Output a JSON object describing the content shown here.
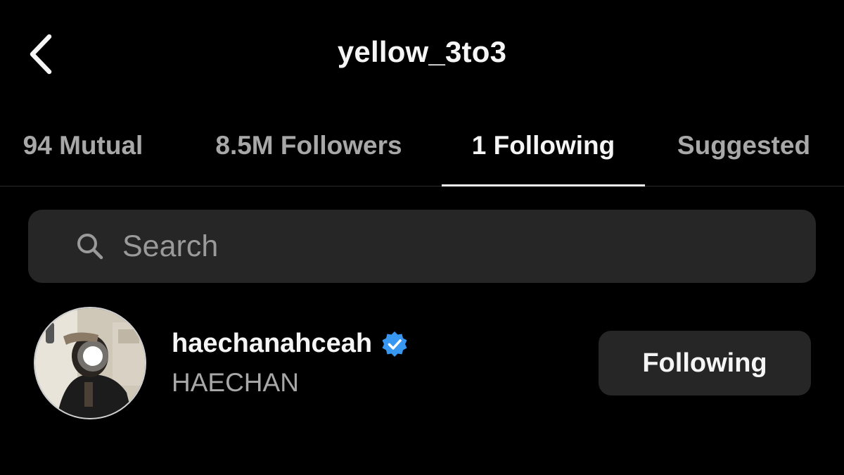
{
  "header": {
    "title": "yellow_3to3",
    "back_icon": "chevron-left-icon"
  },
  "tabs": [
    {
      "label": "94 Mutual",
      "active": false
    },
    {
      "label": "8.5M Followers",
      "active": false
    },
    {
      "label": "1 Following",
      "active": true
    },
    {
      "label": "Suggested",
      "active": false
    }
  ],
  "search": {
    "placeholder": "Search",
    "value": "",
    "icon": "search-icon"
  },
  "users": [
    {
      "username": "haechanahceah",
      "full_name": "HAECHAN",
      "verified": true,
      "button_label": "Following",
      "avatar_icon": "avatar"
    }
  ],
  "colors": {
    "background": "#000000",
    "primary_text": "#f5f5f5",
    "secondary_text": "#a8a8a8",
    "surface": "#262626",
    "verified_badge": "#3897f0"
  }
}
